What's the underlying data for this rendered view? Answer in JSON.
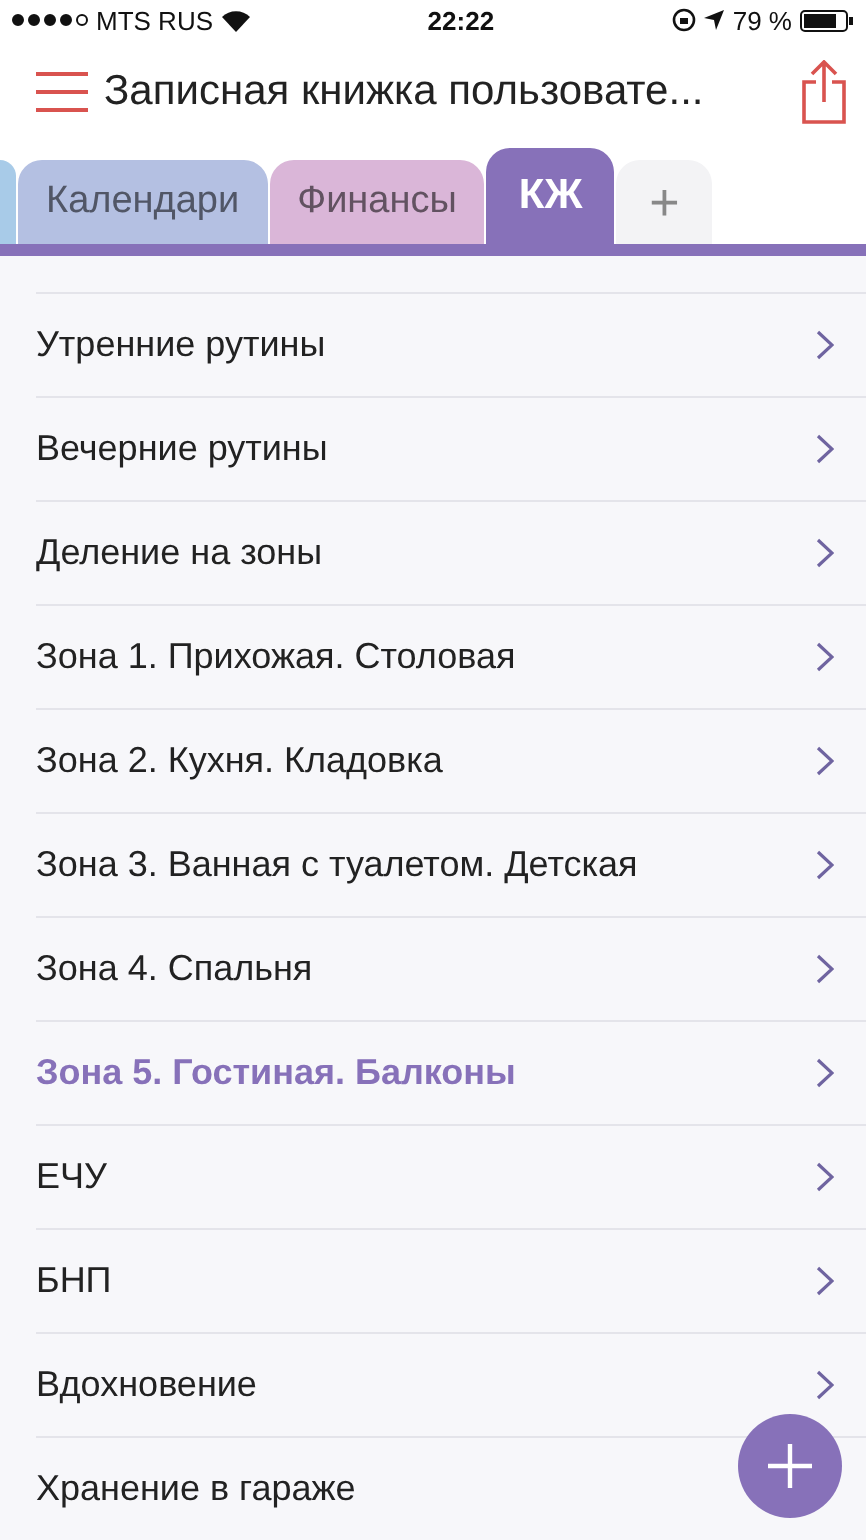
{
  "status_bar": {
    "carrier": "MTS RUS",
    "time": "22:22",
    "battery": "79 %"
  },
  "header": {
    "title": "Записная книжка пользовате..."
  },
  "tabs": [
    {
      "kind": "partial",
      "color": "#a8cbe8",
      "selected": false
    },
    {
      "kind": "tab",
      "label": "Календари",
      "color": "#b4c0e2",
      "selected": false
    },
    {
      "kind": "tab",
      "label": "Финансы",
      "color": "#dab6d8",
      "selected": false
    },
    {
      "kind": "tab",
      "label": "КЖ",
      "color": "#8771b9",
      "selected": true
    },
    {
      "kind": "add",
      "label": "+",
      "color": "#f3f3f5",
      "selected": false
    }
  ],
  "items": [
    {
      "label": "Утренние рутины",
      "selected": false
    },
    {
      "label": "Вечерние рутины",
      "selected": false
    },
    {
      "label": "Деление на зоны",
      "selected": false
    },
    {
      "label": "Зона 1. Прихожая. Столовая",
      "selected": false
    },
    {
      "label": "Зона 2. Кухня. Кладовка",
      "selected": false
    },
    {
      "label": "Зона 3. Ванная с туалетом. Детская",
      "selected": false
    },
    {
      "label": "Зона 4. Спальня",
      "selected": false
    },
    {
      "label": "Зона 5. Гостиная. Балконы",
      "selected": true
    },
    {
      "label": "ЕЧУ",
      "selected": false
    },
    {
      "label": "БНП",
      "selected": false
    },
    {
      "label": "Вдохновение",
      "selected": false
    },
    {
      "label": "Хранение в гараже",
      "selected": false
    }
  ]
}
